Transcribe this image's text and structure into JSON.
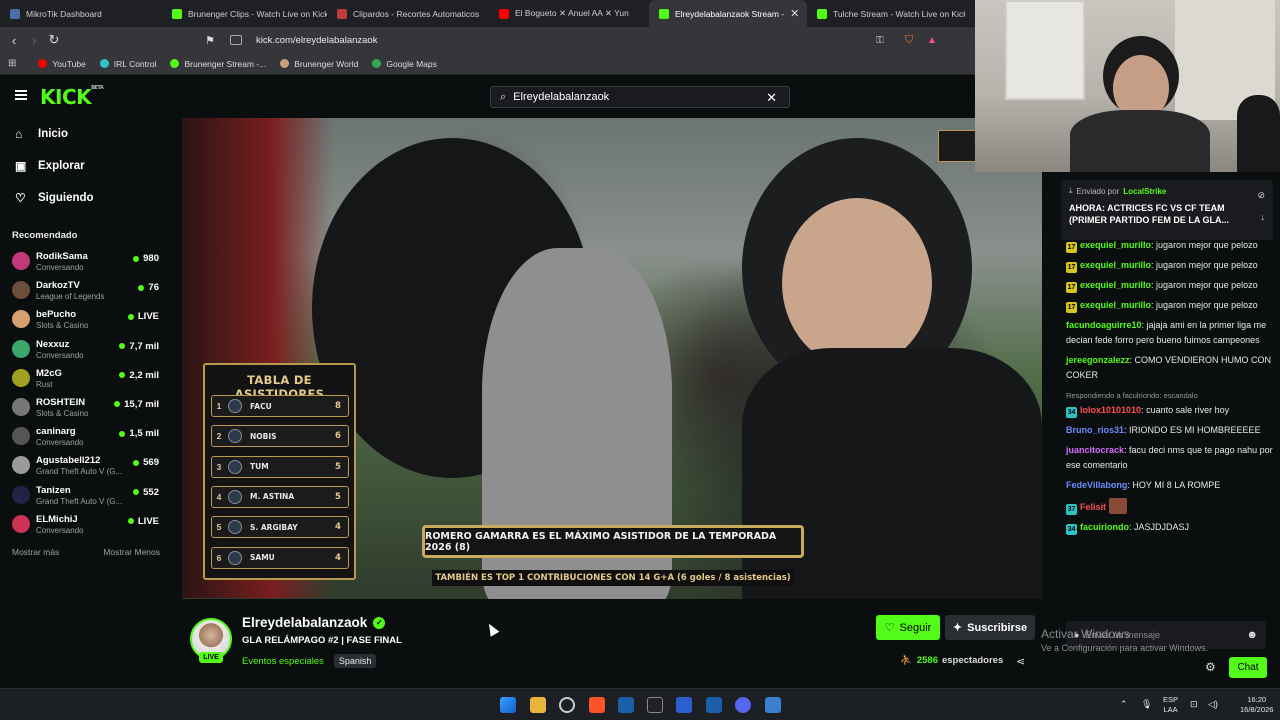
{
  "browser": {
    "tabs": [
      {
        "label": "MikroTik Dashboard",
        "color": "#4a6fa5",
        "active": false
      },
      {
        "label": "Brunenger Clips - Watch Live on Kick",
        "color": "#53fc18",
        "active": false
      },
      {
        "label": "Clipardos - Recortes Automaticos",
        "color": "#c23b3b",
        "active": false
      },
      {
        "label": "El Bogueto ✕ Anuel AA ✕ Yun",
        "color": "#ff0000",
        "active": false
      },
      {
        "label": "Elreydelabalanzaok Stream -",
        "color": "#53fc18",
        "active": true
      },
      {
        "label": "Tulche Stream - Watch Live on Kick",
        "color": "#53fc18",
        "active": false
      }
    ],
    "url": "kick.com/elreydelabalanzaok",
    "bookmarks": [
      {
        "label": "YouTube",
        "color": "#ff0000"
      },
      {
        "label": "IRL Control",
        "color": "#2ec4c4"
      },
      {
        "label": "Brunenger Stream -...",
        "color": "#53fc18"
      },
      {
        "label": "Brunenger World",
        "color": "#c9a07a"
      },
      {
        "label": "Google Maps",
        "color": "#34a853"
      }
    ]
  },
  "kick": {
    "logo": "KICK",
    "logo_badge": "BETA",
    "search_value": "Elreydelabalanzaok"
  },
  "sidebar": {
    "nav": [
      {
        "label": "Inicio",
        "icon": "home-icon",
        "glyph": "⌂"
      },
      {
        "label": "Explorar",
        "icon": "browse-icon",
        "glyph": "▣"
      },
      {
        "label": "Siguiendo",
        "icon": "heart-icon",
        "glyph": "♡"
      }
    ],
    "recommended_title": "Recomendado",
    "channels": [
      {
        "name": "RodikSama",
        "category": "Conversando",
        "viewers": "980",
        "color": "#c0397a"
      },
      {
        "name": "DarkozTV",
        "category": "League of Legends",
        "viewers": "76",
        "color": "#6b4f3a"
      },
      {
        "name": "bePucho",
        "category": "Slots & Casino",
        "viewers": "LIVE",
        "color": "#d4a070"
      },
      {
        "name": "Nexxuz",
        "category": "Conversando",
        "viewers": "7,7 mil",
        "color": "#3aa86b"
      },
      {
        "name": "M2cG",
        "category": "Rust",
        "viewers": "2,2 mil",
        "color": "#a0a020"
      },
      {
        "name": "ROSHTEIN",
        "category": "Slots & Casino",
        "viewers": "15,7 mil",
        "color": "#777777"
      },
      {
        "name": "caninarg",
        "category": "Conversando",
        "viewers": "1,5 mil",
        "color": "#555555"
      },
      {
        "name": "Agustabell212",
        "category": "Grand Theft Auto V (G...",
        "viewers": "569",
        "color": "#9a9a9a"
      },
      {
        "name": "Tanizen",
        "category": "Grand Theft Auto V (G...",
        "viewers": "552",
        "color": "#222244"
      },
      {
        "name": "ELMichiJ",
        "category": "Conversando",
        "viewers": "LIVE",
        "color": "#cc3355"
      }
    ],
    "show_more": "Mostrar más",
    "show_less": "Mostrar Menos"
  },
  "video": {
    "leaderboard_title": "TABLA DE ASISTIDORES",
    "leaderboard": [
      {
        "pos": "1",
        "name": "FACU",
        "val": "8"
      },
      {
        "pos": "2",
        "name": "NOBIS",
        "val": "6"
      },
      {
        "pos": "3",
        "name": "TUM",
        "val": "5"
      },
      {
        "pos": "4",
        "name": "M. ASTINA",
        "val": "5"
      },
      {
        "pos": "5",
        "name": "S. ARGIBAY",
        "val": "4"
      },
      {
        "pos": "6",
        "name": "SAMU",
        "val": "4"
      }
    ],
    "banner": "ROMERO GAMARRA ES EL MÁXIMO ASISTIDOR DE LA TEMPORADA 2026 (8)",
    "banner_sub": "TAMBIÉN ES TOP 1 CONTRIBUCIONES CON 14 G+A (6 goles / 8 asistencias)"
  },
  "stream": {
    "live_label": "LIVE",
    "name": "Elreydelabalanzaok",
    "title": "GLA RELÁMPAGO #2 | FASE FINAL",
    "category": "Eventos especiales",
    "language": "Spanish",
    "follow_label": "Seguir",
    "subscribe_label": "Suscribirse",
    "viewers_count": "2586",
    "viewers_label": "espectadores"
  },
  "chat": {
    "pinned_by_label": "Enviado por",
    "pinned_by_user": "LocalStrike",
    "pinned_text": "AHORA: ACTRICES FC VS CF TEAM (PRIMER PARTIDO FEM DE LA GLA...",
    "messages": [
      {
        "badge": "17",
        "user": "exequiel_murillo",
        "color": "#53fc18",
        "text": "jugaron mejor que pelozo"
      },
      {
        "badge": "17",
        "user": "exequiel_murillo",
        "color": "#53fc18",
        "text": "jugaron mejor que pelozo"
      },
      {
        "badge": "17",
        "user": "exequiel_murillo",
        "color": "#53fc18",
        "text": "jugaron mejor que pelozo"
      },
      {
        "badge": "17",
        "user": "exequiel_murillo",
        "color": "#53fc18",
        "text": "jugaron mejor que pelozo"
      },
      {
        "badge": "",
        "user": "facundoaguirre10",
        "color": "#53fc18",
        "text": "jajaja ami en la primer liga me decian fede forro pero bueno fuimos campeones"
      },
      {
        "badge": "",
        "user": "jereegonzalezz",
        "color": "#53fc18",
        "text": "COMO VENDIERON HUMO CON COKER"
      },
      {
        "reply": "Respondiendo a faculriondo: escandalo",
        "badge": "34",
        "user": "lolox10101010",
        "color": "#ff4d4d",
        "text": "cuanto sale river hoy"
      },
      {
        "badge": "",
        "user": "Bruno_rios31",
        "color": "#6b8cff",
        "text": "IRIONDO ES MI HOMBREEEEE"
      },
      {
        "badge": "",
        "user": "juancitocrack",
        "color": "#d86bff",
        "text": "facu deci nms que te pago nahu por ese comentario"
      },
      {
        "badge": "",
        "user": "FedeVillabong",
        "color": "#6b8cff",
        "text": "HOY MI 8 LA ROMPE"
      },
      {
        "badge": "37",
        "user": "Felisit",
        "color": "#ff4d4d",
        "text": ""
      },
      {
        "badge": "34",
        "user": "facuiriondo",
        "color": "#53fc18",
        "text": "JASJDJDASJ"
      }
    ],
    "input_placeholder": "Enviar un mensaje",
    "chat_button": "Chat"
  },
  "windows": {
    "activate_title": "Activar Windows",
    "activate_sub": "Ve a Configuración para activar Windows.",
    "lang": "ESP",
    "lang2": "LAA",
    "time": "16:20",
    "date": "16/8/2026"
  }
}
